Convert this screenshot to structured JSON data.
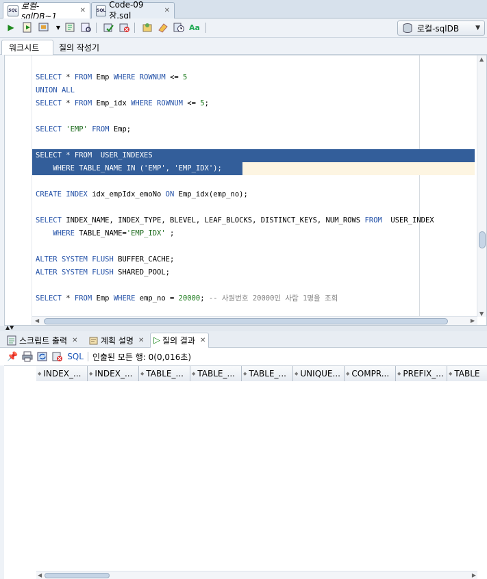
{
  "doc_tabs": [
    {
      "label": "로컬-sqlDB~1",
      "icon": "sql-worksheet-icon"
    },
    {
      "label": "Code-09장.sql",
      "icon": "sql-file-icon"
    }
  ],
  "connection": {
    "label": "로컬-sqlDB"
  },
  "sub_tabs": {
    "worksheet": "워크시트",
    "query_builder": "질의 작성기"
  },
  "code_lines": [
    "SELECT * FROM Emp WHERE ROWNUM <= 5",
    "UNION ALL",
    "SELECT * FROM Emp_idx WHERE ROWNUM <= 5;",
    "",
    "SELECT 'EMP' FROM Emp;",
    "",
    "SELECT * FROM  USER_INDEXES",
    "    WHERE TABLE_NAME IN ('EMP', 'EMP_IDX');",
    "",
    "CREATE INDEX idx_empIdx_emoNo ON Emp_idx(emp_no);",
    "",
    "SELECT INDEX_NAME, INDEX_TYPE, BLEVEL, LEAF_BLOCKS, DISTINCT_KEYS, NUM_ROWS FROM  USER_INDEX",
    "    WHERE TABLE_NAME='EMP_IDX' ;",
    "",
    "ALTER SYSTEM FLUSH BUFFER_CACHE;",
    "ALTER SYSTEM FLUSH SHARED_POOL;",
    "",
    "SELECT * FROM Emp WHERE emp_no = 20000; -- 사원번호 20000인 사람 1명을 조회"
  ],
  "output_tabs": [
    {
      "label": "스크립트 출력",
      "icon": "script-output-icon"
    },
    {
      "label": "계획 설명",
      "icon": "explain-plan-icon"
    },
    {
      "label": "질의 결과",
      "icon": "run-icon"
    }
  ],
  "results": {
    "sql_link": "SQL",
    "status": "인출된 모든 행: 0(0,016초)"
  },
  "columns": [
    "INDEX_...",
    "INDEX_...",
    "TABLE_...",
    "TABLE_...",
    "TABLE_...",
    "UNIQUE...",
    "COMPR...",
    "PREFIX_...",
    "TABLE"
  ],
  "colors": {
    "selection": "#335e9a",
    "keyword": "#2250a7",
    "string": "#1c6a1c",
    "comment": "#808080"
  }
}
